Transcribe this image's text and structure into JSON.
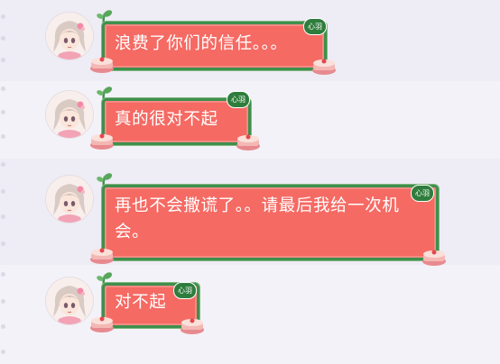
{
  "messages": [
    {
      "text": "浪费了你们的信任。。。",
      "badge": "心羽"
    },
    {
      "text": "真的很对不起",
      "badge": "心羽"
    },
    {
      "text": "再也不会撒谎了。。请最后我给一次机会。",
      "badge": "心羽"
    },
    {
      "text": "对不起",
      "badge": "心羽"
    }
  ],
  "icons": {
    "avatar": "anime-girl-avatar-icon",
    "sprout": "leaf-sprout-icon",
    "cake": "strawberry-cake-icon"
  },
  "colors": {
    "bubble_fill": "#f56a63",
    "bubble_border": "#3f8f4d",
    "badge_bg": "#2f7d3d",
    "background": "#eceaf3"
  }
}
